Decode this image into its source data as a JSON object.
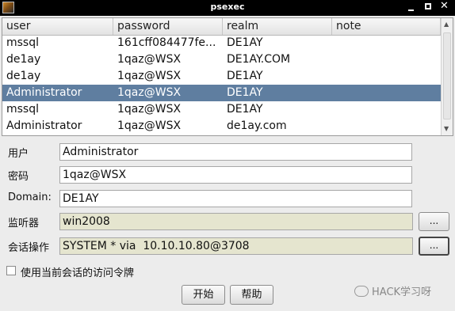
{
  "window": {
    "title": "psexec"
  },
  "table": {
    "columns": [
      "user",
      "password",
      "realm",
      "note"
    ],
    "rows": [
      {
        "user": "mssql",
        "password": "161cff084477fe...",
        "realm": "DE1AY",
        "note": ""
      },
      {
        "user": "de1ay",
        "password": "1qaz@WSX",
        "realm": "DE1AY.COM",
        "note": ""
      },
      {
        "user": "de1ay",
        "password": "1qaz@WSX",
        "realm": "DE1AY",
        "note": ""
      },
      {
        "user": "Administrator",
        "password": "1qaz@WSX",
        "realm": "DE1AY",
        "note": "",
        "selected": true
      },
      {
        "user": "mssql",
        "password": "1qaz@WSX",
        "realm": "DE1AY",
        "note": ""
      },
      {
        "user": "Administrator",
        "password": "1qaz@WSX",
        "realm": "de1ay.com",
        "note": ""
      }
    ],
    "selected_color": "#5f7ea0"
  },
  "form": {
    "user_label": "用户",
    "user_value": "Administrator",
    "password_label": "密码",
    "password_value": "1qaz@WSX",
    "domain_label": "Domain:",
    "domain_value": "DE1AY",
    "listener_label": "监听器",
    "listener_value": "win2008",
    "listener_button": "...",
    "session_label": "会话操作",
    "session_value": "SYSTEM * via  10.10.10.80@3708",
    "session_button": "...",
    "use_token_label": "使用当前会话的访问令牌",
    "use_token_checked": false
  },
  "buttons": {
    "start": "开始",
    "help": "帮助"
  },
  "watermark": {
    "text": "HACK学习呀"
  },
  "icons": {
    "app": "app-icon",
    "minimize": "minimize-icon",
    "maximize": "maximize-icon",
    "close": "close-icon",
    "scroll_up": "scroll-up-arrow-icon",
    "scroll_down": "scroll-down-arrow-icon"
  }
}
